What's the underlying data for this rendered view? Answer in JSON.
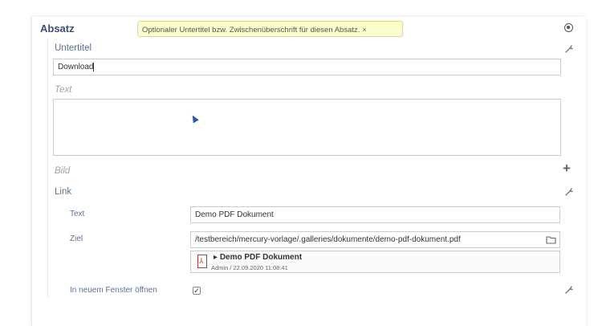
{
  "section": {
    "title": "Absatz",
    "tooltip": "Optionaler Untertitel bzw. Zwischenüberschrift für diesen Absatz.",
    "tooltip_close": "×"
  },
  "untertitel": {
    "label": "Untertitel",
    "value": "Download"
  },
  "text": {
    "label": "Text",
    "value": ""
  },
  "bild": {
    "label": "Bild"
  },
  "link": {
    "label": "Link",
    "text_label": "Text",
    "text_value": "Demo PDF Dokument",
    "ziel_label": "Ziel",
    "ziel_value": "/testbereich/mercury-vorlage/.galleries/dokumente/demo-pdf-dokument.pdf",
    "file_name": "Demo PDF Dokument",
    "file_meta": "Admin / 22.09.2020 11:08:41",
    "new_window_label": "In neuem Fenster öffnen",
    "new_window_checked": true
  },
  "icons": {
    "circle": "circle-dot-icon",
    "wrench": "wrench-icon",
    "plus": "plus-icon",
    "folder": "folder-icon",
    "pdf": "pdf-file-icon",
    "pointer": "mouse-pointer-icon"
  },
  "colors": {
    "label": "#5b7394",
    "title": "#36507a",
    "tooltip_bg": "#fdfccc",
    "pdf_red": "#c0392b"
  }
}
